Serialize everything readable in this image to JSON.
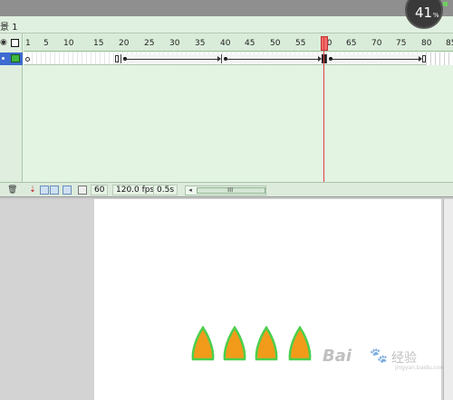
{
  "scene": {
    "label": "景 1"
  },
  "zoom": {
    "value": "41",
    "unit": "%"
  },
  "ruler": {
    "ticks": [
      "1",
      "5",
      "10",
      "15",
      "20",
      "25",
      "30",
      "35",
      "40",
      "45",
      "50",
      "55",
      "60",
      "65",
      "70",
      "75",
      "80",
      "85"
    ]
  },
  "status": {
    "current_frame": "60",
    "fps": "120.0 fps",
    "elapsed": "0.5s",
    "scroll_grip": "III",
    "scroll_left": "◂"
  },
  "watermark": {
    "brand": "Bai",
    "paw": "🐾",
    "cn": "经验",
    "sub": "jingyan.baidu.com"
  },
  "colors": {
    "timeline_bg": "#e3f4e3",
    "playhead": "#e04040",
    "layer_selected": "#3d6bd1",
    "cone_fill": "#f29a1a",
    "cone_outline": "#4ccf4c"
  },
  "icons": {
    "eye": "eye-icon",
    "outline": "outline-icon",
    "trash": "trash-icon",
    "onion_skin": "onion-skin-icon"
  }
}
